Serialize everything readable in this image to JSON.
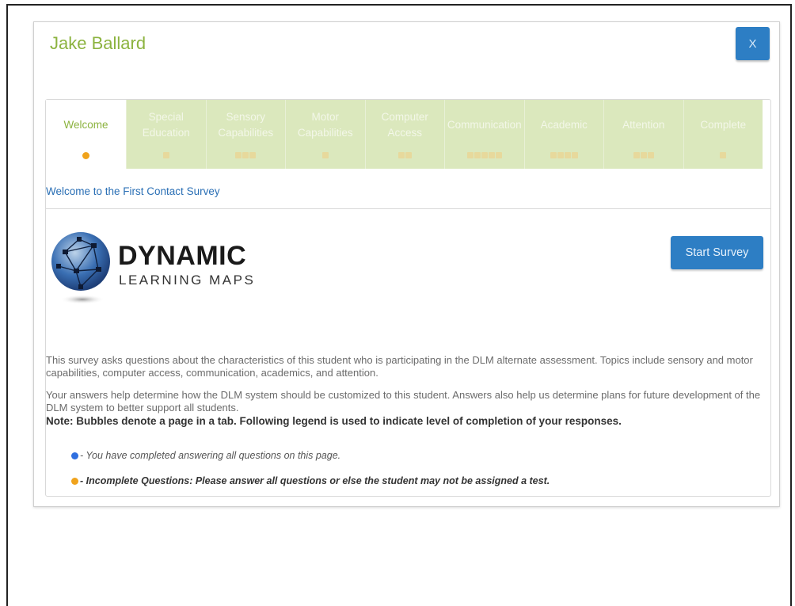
{
  "dialog": {
    "student_name": "Jake Ballard",
    "close_label": "X"
  },
  "tabs": [
    {
      "label": "Welcome",
      "bubbles": 1,
      "active": true
    },
    {
      "label": "Special\nEducation",
      "bubbles": 1,
      "active": false
    },
    {
      "label": "Sensory\nCapabilities",
      "bubbles": 3,
      "active": false
    },
    {
      "label": "Motor\nCapabilities",
      "bubbles": 1,
      "active": false
    },
    {
      "label": "Computer\nAccess",
      "bubbles": 2,
      "active": false
    },
    {
      "label": "Communication",
      "bubbles": 5,
      "active": false
    },
    {
      "label": "Academic",
      "bubbles": 4,
      "active": false
    },
    {
      "label": "Attention",
      "bubbles": 3,
      "active": false
    },
    {
      "label": "Complete",
      "bubbles": 1,
      "active": false
    }
  ],
  "welcome": {
    "link_text": "Welcome to the First Contact Survey",
    "logo_title": "DYNAMIC",
    "logo_subtitle": "LEARNING MAPS",
    "start_label": "Start Survey",
    "para1": "This survey asks questions about the characteristics of this student who is participating in the DLM alternate assessment. Topics include sensory and motor capabilities, computer access, communication, academics, and attention.",
    "para2": "Your answers help determine how the DLM system should be customized to this student. Answers also help us determine plans for future development of the DLM system to better support all students.",
    "note": "Note: Bubbles denote a page in a tab. Following legend is used to indicate level of completion of your responses.",
    "legend_complete": "- You have completed answering all questions on this page.",
    "legend_incomplete": "- Incomplete Questions: Please answer all questions or else the student may not be assigned a test."
  },
  "colors": {
    "accent_green": "#8cb33f",
    "button_blue": "#2d7ec4",
    "complete_dot": "#2f6fe0",
    "incomplete_dot": "#f0a31c",
    "tab_inactive_bg": "#dbe8bd"
  }
}
